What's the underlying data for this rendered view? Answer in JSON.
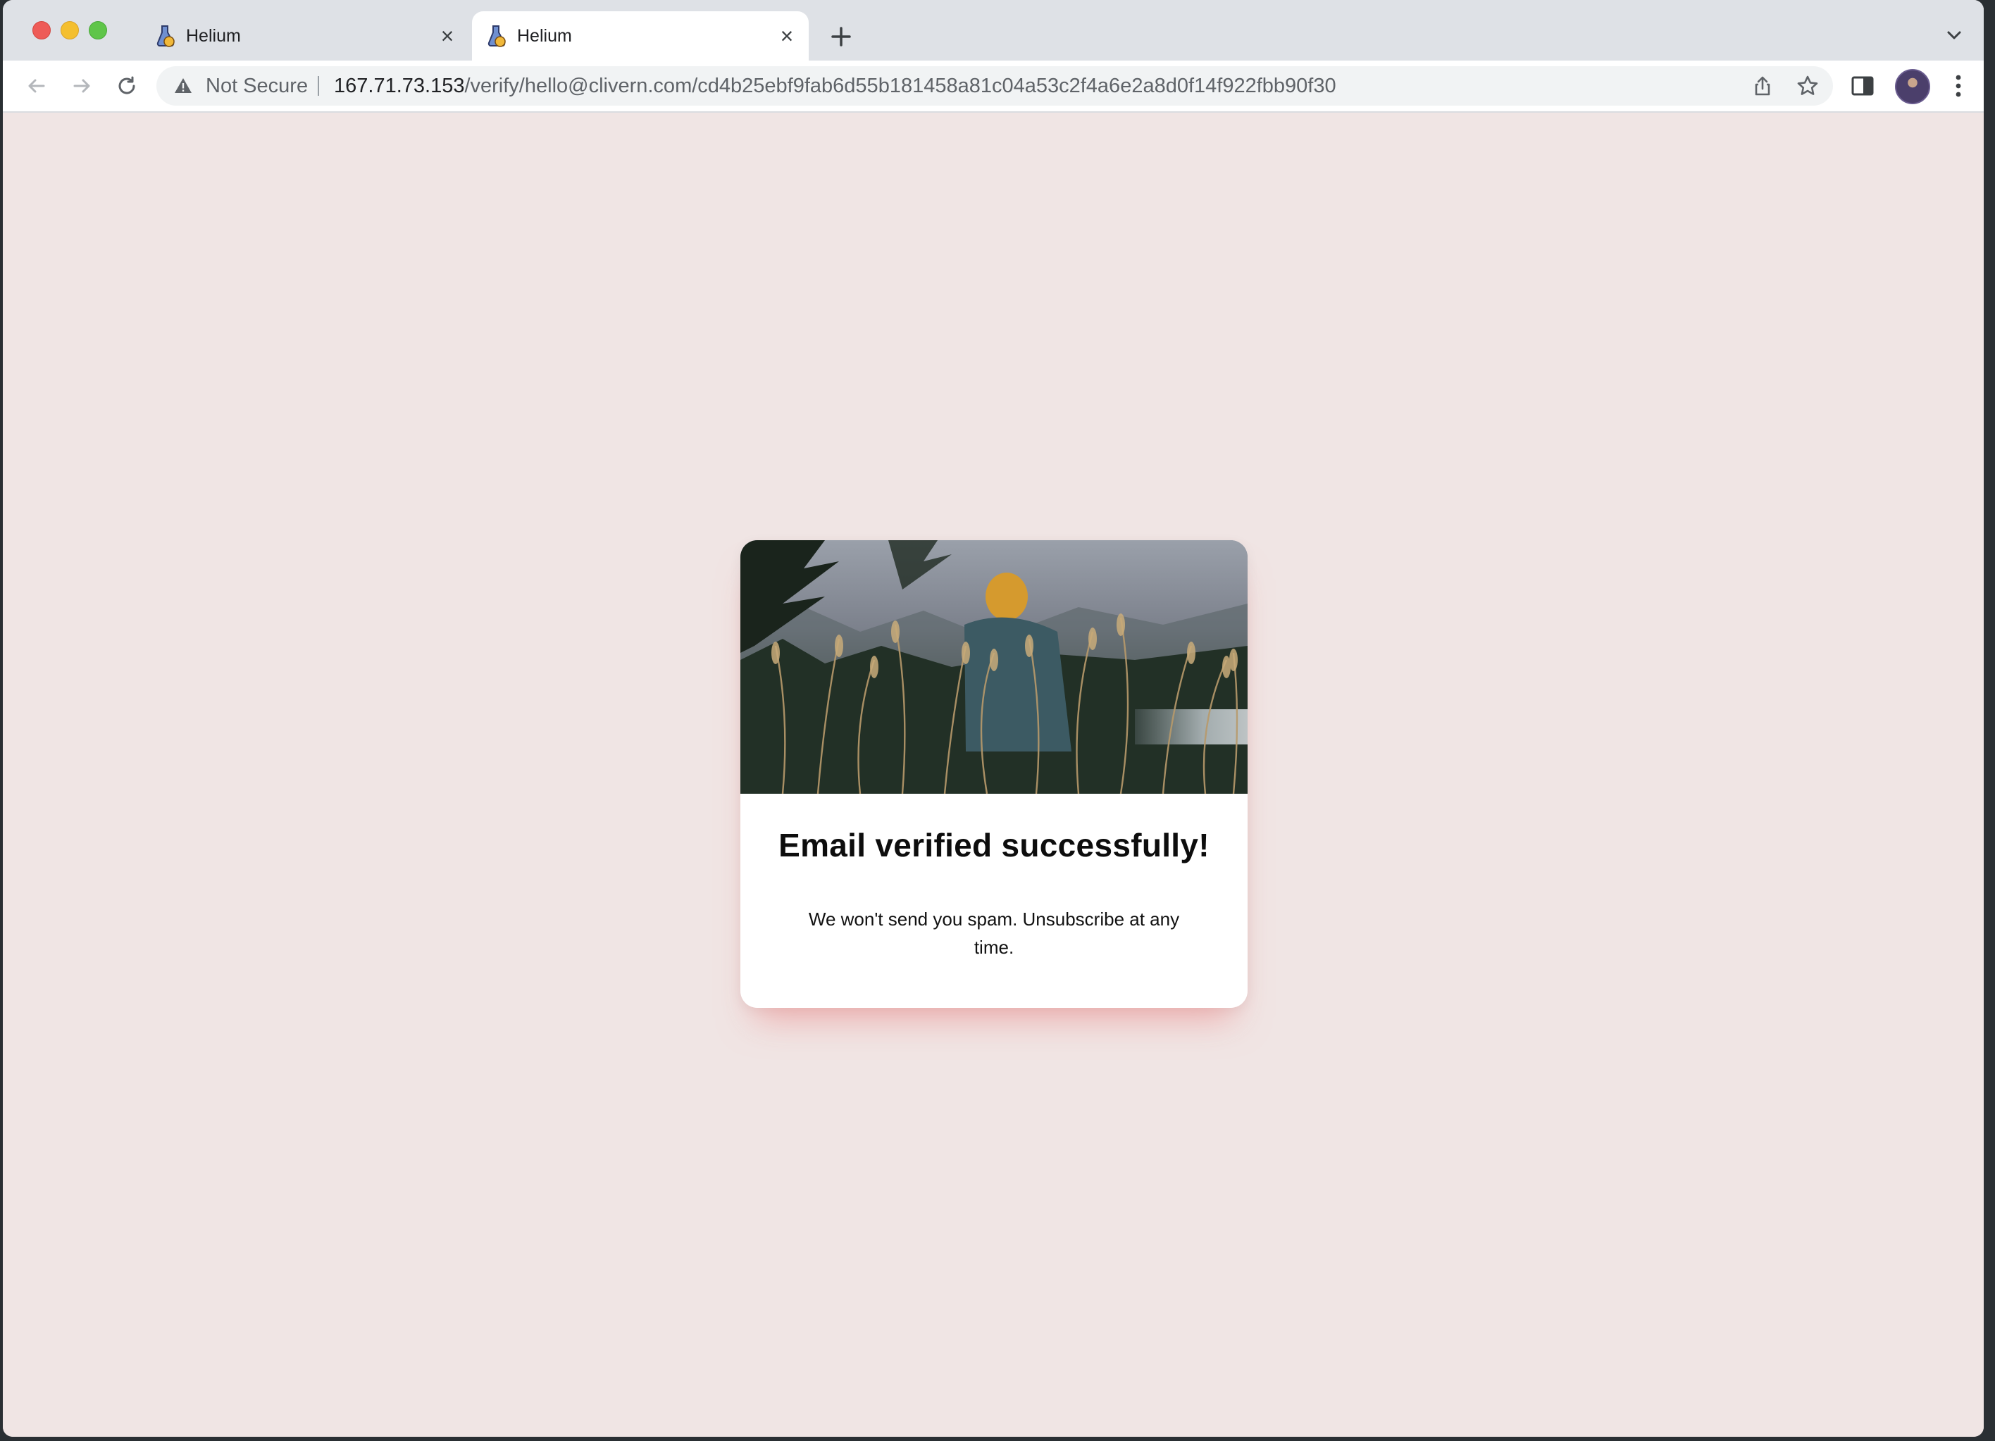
{
  "browser": {
    "tabs": [
      {
        "title": "Helium",
        "active": false
      },
      {
        "title": "Helium",
        "active": true
      }
    ],
    "security_label": "Not Secure",
    "url_host": "167.71.73.153",
    "url_path": "/verify/hello@clivern.com/cd4b25ebf9fab6d55b181458a81c04a53c2f4a6e2a8d0f14f922fbb90f30"
  },
  "card": {
    "headline": "Email verified successfully!",
    "subtext": "We won't send you spam. Unsubscribe at any time."
  },
  "colors": {
    "page_background": "#f0e5e4",
    "card_background": "#ffffff",
    "card_shadow": "#ec9696"
  },
  "icons": [
    "back-arrow-icon",
    "forward-arrow-icon",
    "reload-icon",
    "warning-icon",
    "share-icon",
    "star-icon",
    "side-panel-icon",
    "kebab-menu-icon",
    "tab-search-icon",
    "close-icon",
    "plus-icon"
  ]
}
